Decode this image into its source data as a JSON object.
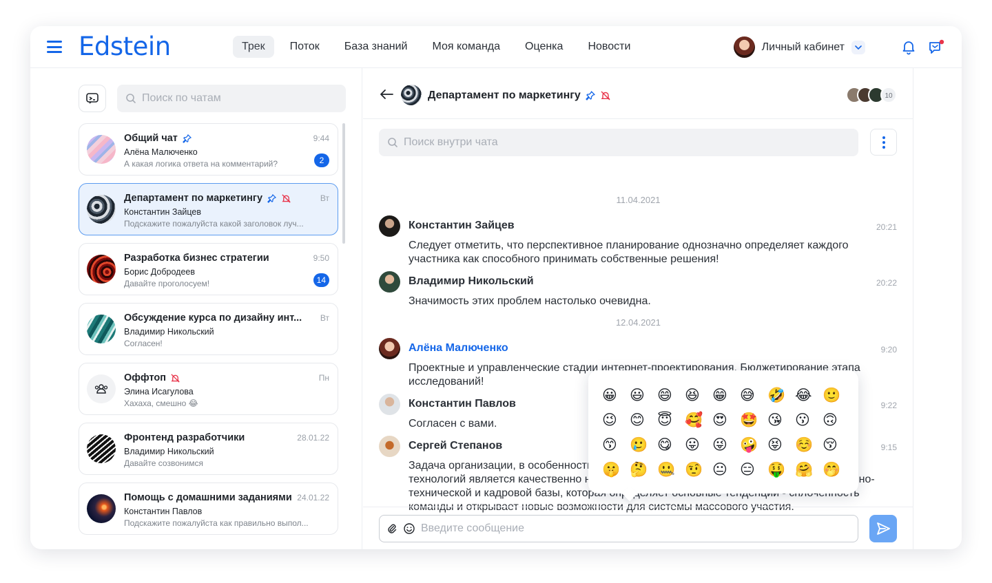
{
  "header": {
    "logo": "Edstein",
    "nav": [
      {
        "label": "Трек",
        "active": true
      },
      {
        "label": "Поток",
        "active": false
      },
      {
        "label": "База знаний",
        "active": false
      },
      {
        "label": "Моя команда",
        "active": false
      },
      {
        "label": "Оценка",
        "active": false
      },
      {
        "label": "Новости",
        "active": false
      }
    ],
    "profile_label": "Личный кабинет"
  },
  "sidebar": {
    "search_placeholder": "Поиск по чатам",
    "chats": [
      {
        "title": "Общий чат",
        "pinned": true,
        "muted": false,
        "time": "9:44",
        "author": "Алёна Малюченко",
        "preview": "А какая логика ответа на комментарий?",
        "badge": "2",
        "avatar": "pastel-stripes"
      },
      {
        "title": "Департамент по маркетингу",
        "pinned": true,
        "muted": true,
        "time": "Вт",
        "author": "Константин Зайцев",
        "preview": "Подскажите пожалуйста какой заголовок луч...",
        "badge": "",
        "avatar": "marble-dark",
        "active": true
      },
      {
        "title": "Разработка бизнес стратегии",
        "pinned": false,
        "muted": false,
        "time": "9:50",
        "author": "Борис Добродеев",
        "preview": "Давайте проголосуем!",
        "badge": "14",
        "avatar": "red-swirl"
      },
      {
        "title": "Обсуждение курса по дизайну инт...",
        "pinned": false,
        "muted": false,
        "time": "Вт",
        "author": "Владимир Никольский",
        "preview": "Согласен!",
        "badge": "",
        "avatar": "teal-marble"
      },
      {
        "title": "Оффтоп",
        "pinned": false,
        "muted": true,
        "time": "Пн",
        "author": "Элина Исагулова",
        "preview": "Хахаха, смешно 😂",
        "badge": "",
        "avatar": "group-icon"
      },
      {
        "title": "Фронтенд разработчики",
        "pinned": false,
        "muted": false,
        "time": "28.01.22",
        "author": "Владимир Никольский",
        "preview": "Давайте созвонимся",
        "badge": "",
        "avatar": "black-waves"
      },
      {
        "title": "Помощь с домашними заданиями",
        "pinned": false,
        "muted": false,
        "time": "24.01.22",
        "author": "Константин Павлов",
        "preview": "Подскажите пожалуйста как правильно выпол...",
        "badge": "",
        "avatar": "orange-streak"
      }
    ]
  },
  "chat": {
    "title": "Департамент по маркетингу",
    "members_count": "10",
    "search_placeholder": "Поиск внутри чата",
    "dates": [
      "11.04.2021",
      "12.04.2021"
    ],
    "messages": [
      {
        "name": "Константин Зайцев",
        "time": "20:21",
        "text": "Следует отметить, что перспективное планирование однозначно определяет каждого участника как способного принимать собственные решения!",
        "me": false
      },
      {
        "name": "Владимир Никольский",
        "time": "20:22",
        "text": "Значимость этих проблем настолько очевидна.",
        "me": false
      },
      {
        "name": "Алёна Малюченко",
        "time": "9:20",
        "text": "Проектные и управленческие стадии интернет-проектирования. Бюджетирование этапа исследований!",
        "me": true
      },
      {
        "name": "Константин Павлов",
        "time": "9:22",
        "text": "Согласен с вами.",
        "me": false
      },
      {
        "name": "Сергей Степанов",
        "time": "9:15",
        "text": "Задача организации, в особенности же новая модель организационной деятельности и технологий является качественно новой ступенью как самих ресурсов, так и материально-технической и кадровой базы, которая определяет основные тенденции - сплочённость команды и открывает новые возможности для системы массового участия.",
        "me": false
      }
    ],
    "input_placeholder": "Введите сообщение"
  },
  "emoji_picker": {
    "emojis": [
      "😀",
      "😃",
      "😄",
      "😆",
      "😁",
      "😅",
      "🤣",
      "😂",
      "🙂",
      "😉",
      "😊",
      "😇",
      "🥰",
      "😍",
      "🤩",
      "😘",
      "😗",
      "🙃",
      "😙",
      "🥲",
      "😋",
      "😛",
      "😜",
      "🤪",
      "😝",
      "☺️",
      "😚",
      "🤫",
      "🤔",
      "🤐",
      "🤨",
      "😐",
      "😑",
      "🤑",
      "🤗",
      "🤭"
    ]
  }
}
